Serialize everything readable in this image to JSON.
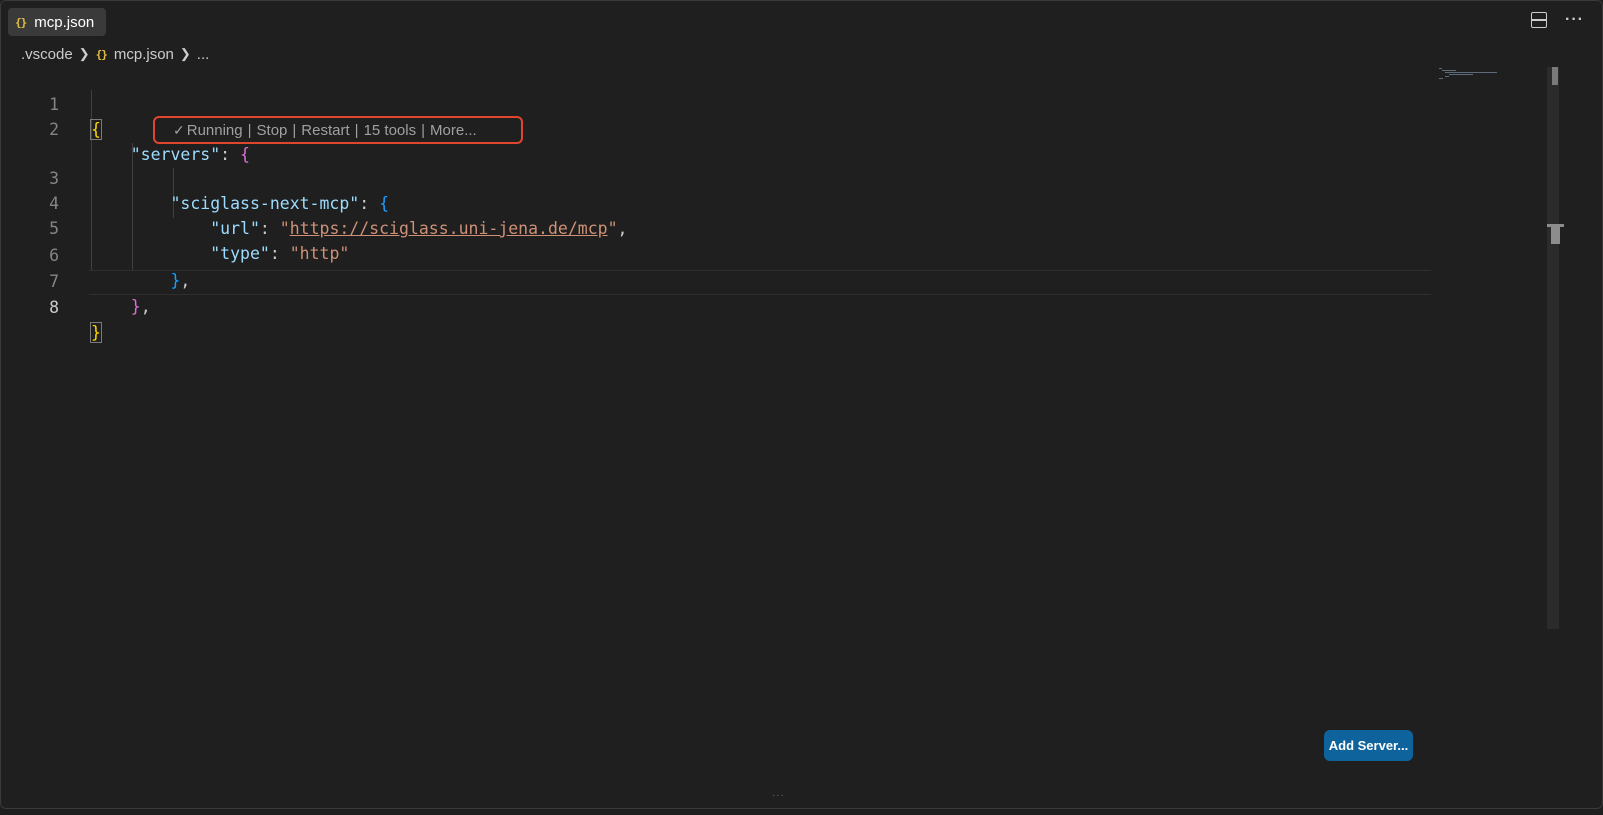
{
  "tab": {
    "icon": "json-braces-icon",
    "glyph": "{}",
    "label": "mcp.json"
  },
  "top_actions": {
    "split_icon": "split-editor-icon",
    "more_glyph": "···"
  },
  "breadcrumb": {
    "folder": ".vscode",
    "file_glyph": "{}",
    "file": "mcp.json",
    "more": "..."
  },
  "codelens": {
    "status_glyph": "✓",
    "status": "Running",
    "separator": "|",
    "stop": "Stop",
    "restart": "Restart",
    "tools": "15 tools",
    "more": "More..."
  },
  "code": {
    "line_numbers": [
      "1",
      "2",
      "3",
      "4",
      "5",
      "6",
      "7",
      "8"
    ],
    "l1_open": "{",
    "l2_key": "\"servers\"",
    "l2_colon": ": ",
    "l2_brace": "{",
    "l3_key": "\"sciglass-next-mcp\"",
    "l3_colon": ": ",
    "l3_brace": "{",
    "l4_key": "\"url\"",
    "l4_colon": ": ",
    "l4_quote_open": "\"",
    "l4_url": "https://sciglass.uni-jena.de/mcp",
    "l4_quote_close": "\"",
    "l4_comma": ",",
    "l5_key": "\"type\"",
    "l5_colon": ": ",
    "l5_value": "\"http\"",
    "l6_close": "}",
    "l6_comma": ",",
    "l7_close": "}",
    "l7_comma": ",",
    "l8_close": "}"
  },
  "colors": {
    "key": "#9cdcfe",
    "string": "#ce9178",
    "bracket_level1": "#ffd700",
    "bracket_level2": "#da70d6",
    "bracket_level3": "#179fff",
    "highlight_border": "#e0452e",
    "button": "#0e639c"
  },
  "add_server_button": {
    "label": "Add Server..."
  }
}
